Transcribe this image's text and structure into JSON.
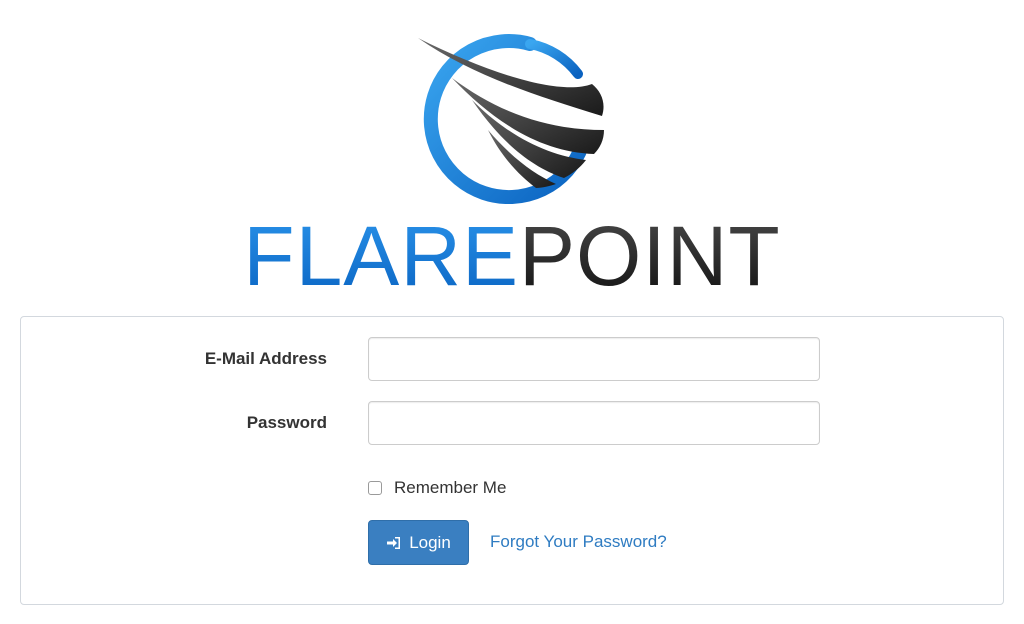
{
  "brand": {
    "logo_icon": "flare-swoosh-logo",
    "name_part1": "FLARE",
    "name_part2": "POINT",
    "colors": {
      "blue": "#0b7ad6",
      "dark": "#222222"
    }
  },
  "login_form": {
    "email_label": "E-Mail Address",
    "email_value": "",
    "password_label": "Password",
    "password_value": "",
    "remember_label": "Remember Me",
    "remember_checked": false,
    "login_button_label": "Login",
    "login_icon": "sign-in-icon",
    "forgot_link_label": "Forgot Your Password?",
    "colors": {
      "button": "#3a7fc1",
      "link": "#2f7cc2"
    }
  }
}
